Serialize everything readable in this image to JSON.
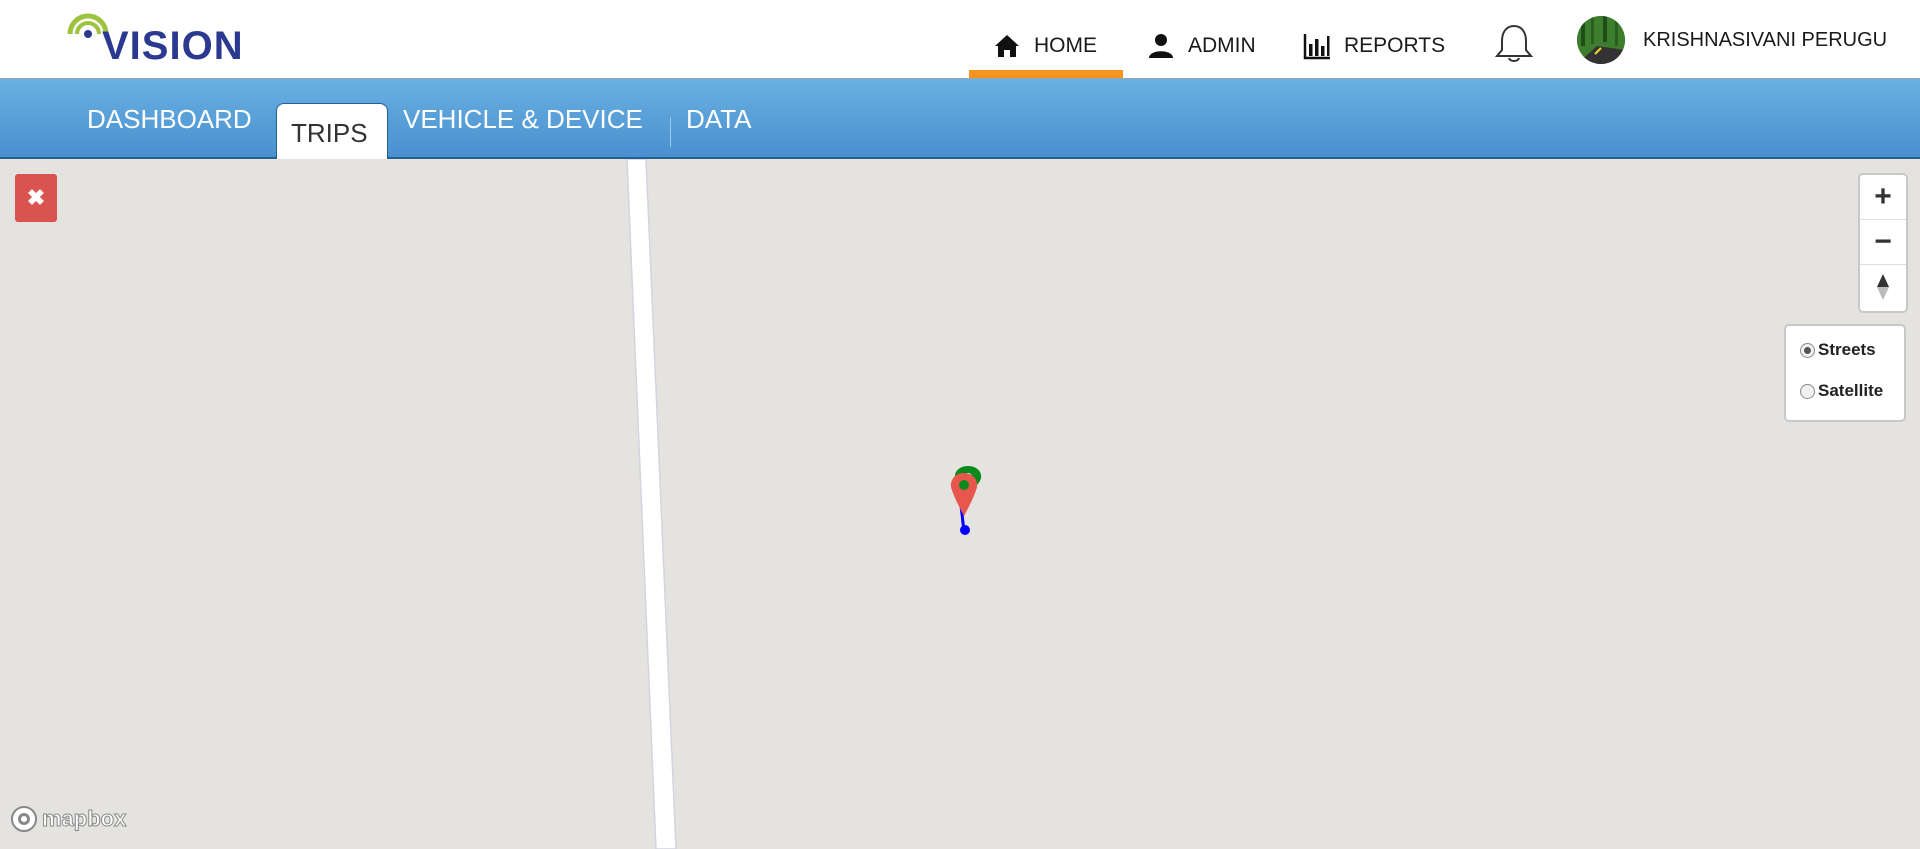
{
  "header": {
    "logo_text": "VISION",
    "nav": {
      "home": "HOME",
      "admin": "ADMIN",
      "reports": "REPORTS"
    },
    "active_nav": "HOME",
    "user_name": "KRISHNASIVANI PERUGU",
    "accent_color": "#f7941d",
    "icons": [
      "home-icon",
      "admin-user-icon",
      "reports-chart-icon",
      "bell-icon",
      "user-avatar"
    ]
  },
  "subnav": {
    "tabs": {
      "dashboard": "DASHBOARD",
      "trips": "TRIPS",
      "vehicle": "VEHICLE & DEVICE",
      "data": "DATA"
    },
    "active_tab": "TRIPS"
  },
  "map": {
    "style_options": {
      "streets": "Streets",
      "satellite": "Satellite"
    },
    "selected_style": "Streets",
    "controls": [
      "zoom-in",
      "zoom-out",
      "compass"
    ],
    "close_icon": "close-icon",
    "attribution": "mapbox",
    "marker_colors": {
      "start": "#0a8a1a",
      "end": "#e8574d",
      "route": "#0000ff"
    }
  }
}
